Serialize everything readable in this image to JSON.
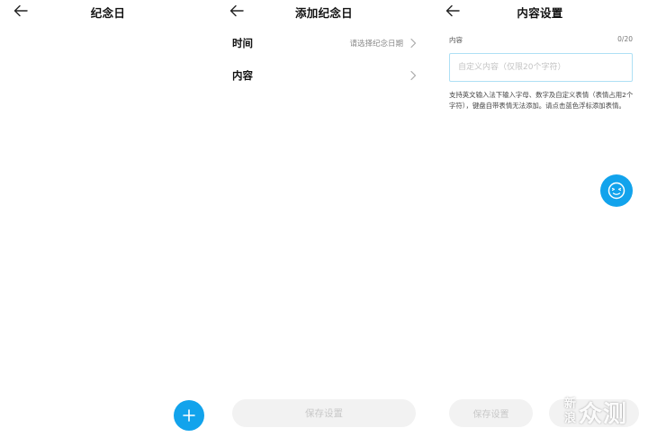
{
  "colors": {
    "accent": "#12a3ec",
    "disabled_button": "#f2f2f2",
    "disabled_text": "#c8c8c8",
    "input_border": "#aee0f5"
  },
  "panel1": {
    "title": "纪念日",
    "back_icon": "arrow-left-icon",
    "fab_icon": "plus-icon"
  },
  "panel2": {
    "title": "添加纪念日",
    "rows": [
      {
        "label": "时间",
        "hint": "请选择纪念日期"
      },
      {
        "label": "内容",
        "hint": ""
      }
    ],
    "save_label": "保存设置"
  },
  "panel3": {
    "title": "内容设置",
    "field_label": "内容",
    "counter": "0/20",
    "input_value": "",
    "input_placeholder": "自定义内容（仅限20个字符）",
    "help_text": "支持英文输入法下输入字母、数字及自定义表情（表情占用2个字符），键盘自带表情无法添加。请点击蓝色浮标添加表情。",
    "emoji_icon": "emoji-face-icon",
    "save_label": "保存设置"
  },
  "watermark": {
    "small_top": "新",
    "small_bottom": "浪",
    "big": "众测"
  }
}
